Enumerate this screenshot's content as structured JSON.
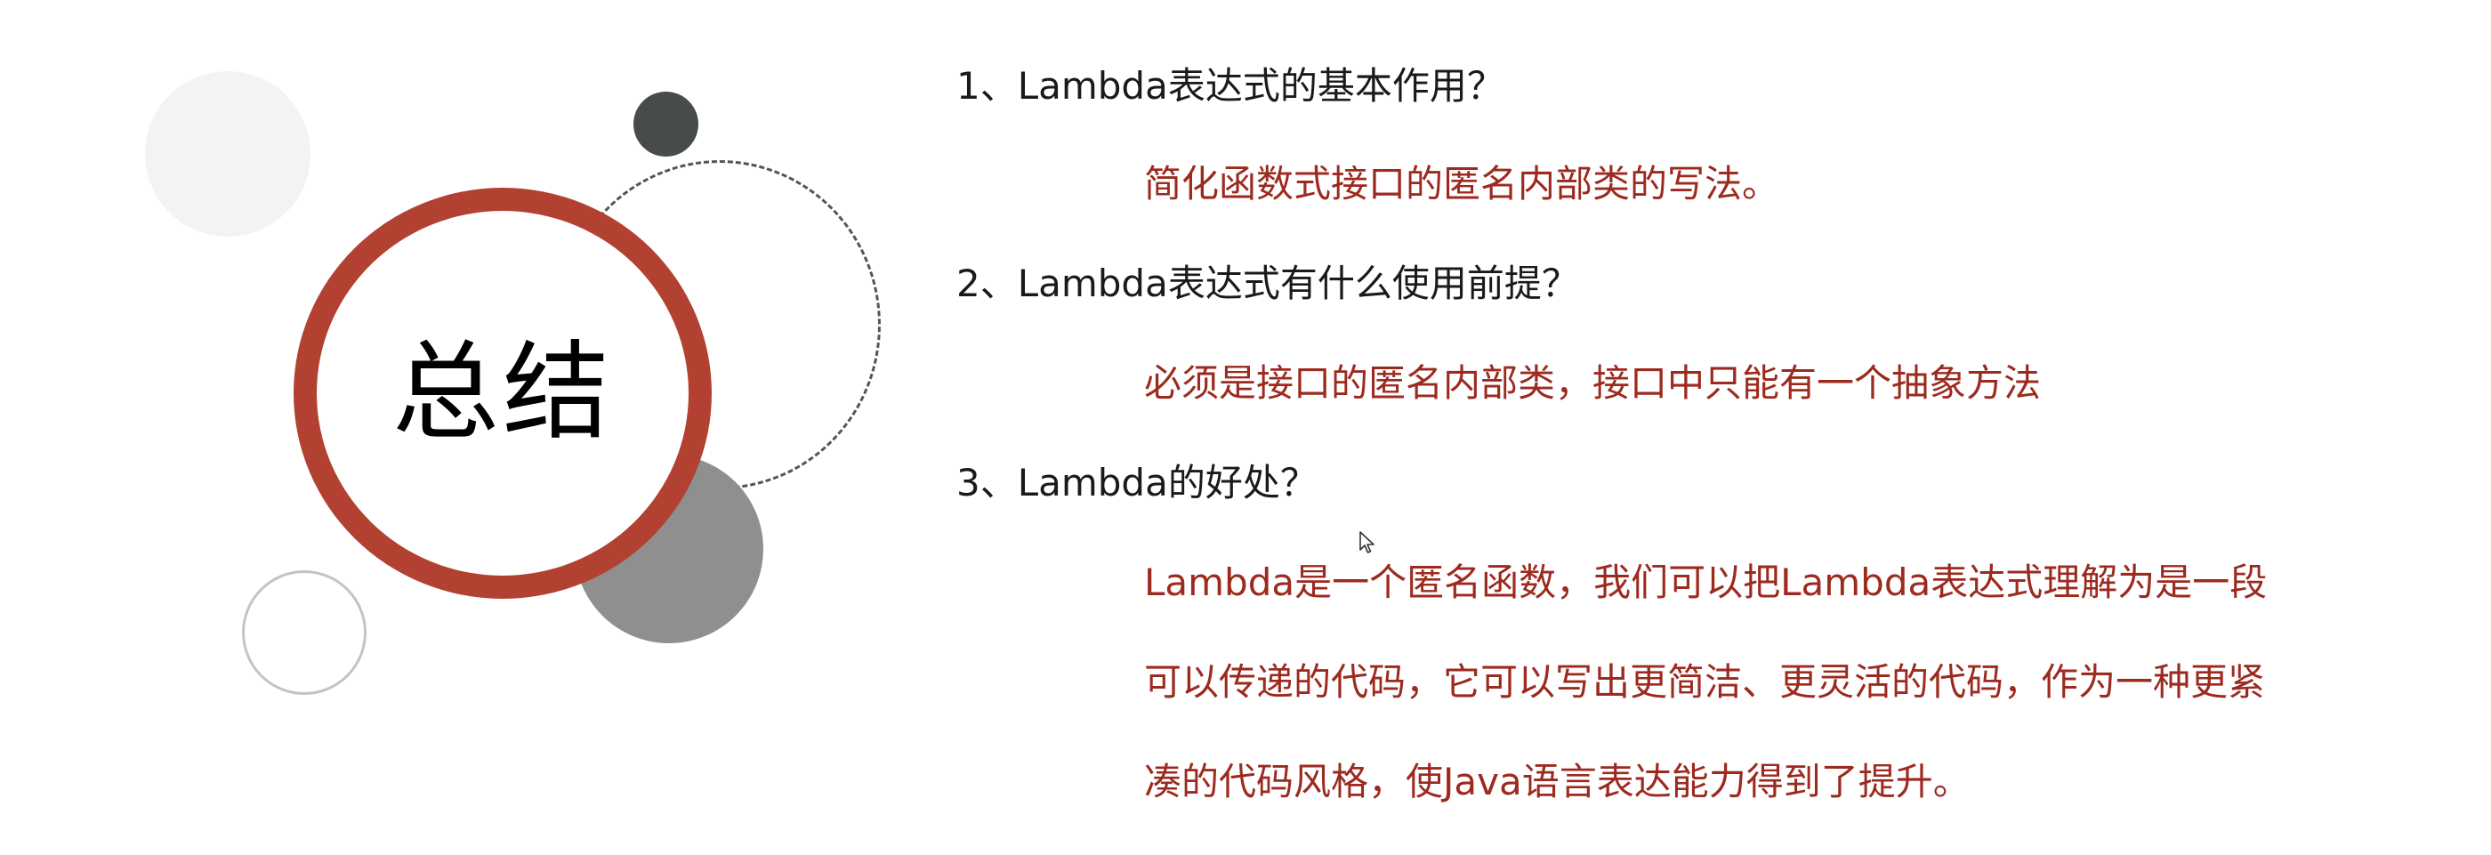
{
  "slide": {
    "title": "总结",
    "items": [
      {
        "question": "1、Lambda表达式的基本作用？",
        "answer_lines": [
          "简化函数式接口的匿名内部类的写法。"
        ]
      },
      {
        "question": "2、Lambda表达式有什么使用前提？",
        "answer_lines": [
          "必须是接口的匿名内部类，接口中只能有一个抽象方法"
        ]
      },
      {
        "question": "3、Lambda的好处？",
        "answer_lines": [
          "Lambda是一个匿名函数，我们可以把Lambda表达式理解为是一段",
          "可以传递的代码，它可以写出更简洁、更灵活的代码，作为一种更紧",
          "凑的代码风格，使Java语言表达能力得到了提升。"
        ]
      }
    ]
  },
  "colors": {
    "accent": "#b24131",
    "answer_text": "#9c2a1f",
    "question_text": "#1a1a1a",
    "dark_dot": "#474b4b",
    "gray_circle": "#8f8f8f",
    "light_circle": "#f3f3f3"
  },
  "icons": {
    "cursor": "mouse-pointer-icon"
  }
}
